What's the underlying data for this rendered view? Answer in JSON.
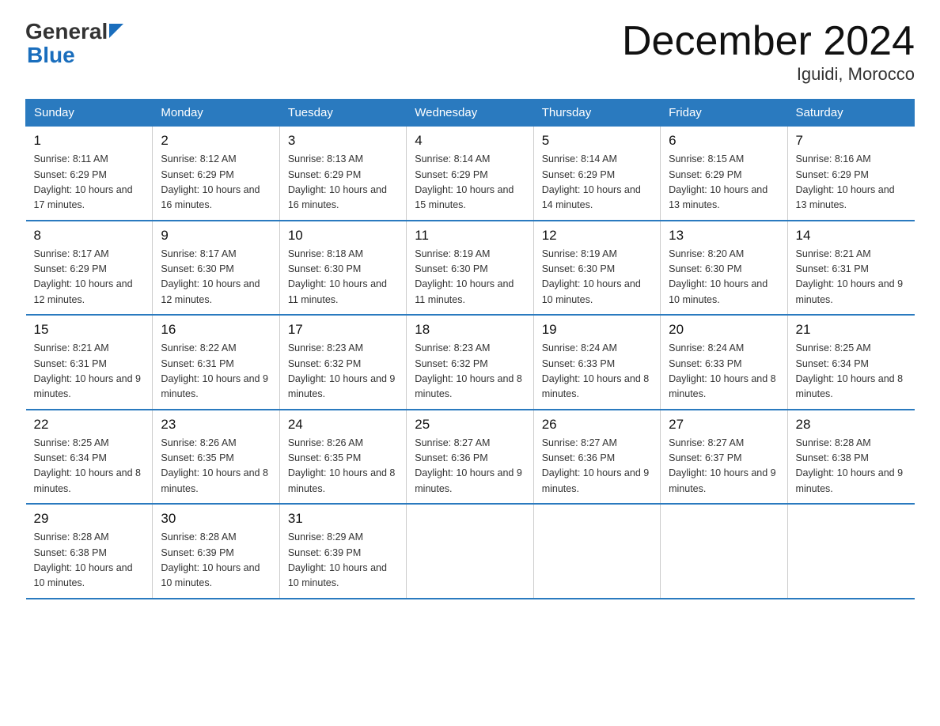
{
  "logo": {
    "general": "General",
    "blue": "Blue"
  },
  "title": "December 2024",
  "location": "Iguidi, Morocco",
  "days_of_week": [
    "Sunday",
    "Monday",
    "Tuesday",
    "Wednesday",
    "Thursday",
    "Friday",
    "Saturday"
  ],
  "weeks": [
    [
      {
        "day": "1",
        "sunrise": "8:11 AM",
        "sunset": "6:29 PM",
        "daylight": "10 hours and 17 minutes."
      },
      {
        "day": "2",
        "sunrise": "8:12 AM",
        "sunset": "6:29 PM",
        "daylight": "10 hours and 16 minutes."
      },
      {
        "day": "3",
        "sunrise": "8:13 AM",
        "sunset": "6:29 PM",
        "daylight": "10 hours and 16 minutes."
      },
      {
        "day": "4",
        "sunrise": "8:14 AM",
        "sunset": "6:29 PM",
        "daylight": "10 hours and 15 minutes."
      },
      {
        "day": "5",
        "sunrise": "8:14 AM",
        "sunset": "6:29 PM",
        "daylight": "10 hours and 14 minutes."
      },
      {
        "day": "6",
        "sunrise": "8:15 AM",
        "sunset": "6:29 PM",
        "daylight": "10 hours and 13 minutes."
      },
      {
        "day": "7",
        "sunrise": "8:16 AM",
        "sunset": "6:29 PM",
        "daylight": "10 hours and 13 minutes."
      }
    ],
    [
      {
        "day": "8",
        "sunrise": "8:17 AM",
        "sunset": "6:29 PM",
        "daylight": "10 hours and 12 minutes."
      },
      {
        "day": "9",
        "sunrise": "8:17 AM",
        "sunset": "6:30 PM",
        "daylight": "10 hours and 12 minutes."
      },
      {
        "day": "10",
        "sunrise": "8:18 AM",
        "sunset": "6:30 PM",
        "daylight": "10 hours and 11 minutes."
      },
      {
        "day": "11",
        "sunrise": "8:19 AM",
        "sunset": "6:30 PM",
        "daylight": "10 hours and 11 minutes."
      },
      {
        "day": "12",
        "sunrise": "8:19 AM",
        "sunset": "6:30 PM",
        "daylight": "10 hours and 10 minutes."
      },
      {
        "day": "13",
        "sunrise": "8:20 AM",
        "sunset": "6:30 PM",
        "daylight": "10 hours and 10 minutes."
      },
      {
        "day": "14",
        "sunrise": "8:21 AM",
        "sunset": "6:31 PM",
        "daylight": "10 hours and 9 minutes."
      }
    ],
    [
      {
        "day": "15",
        "sunrise": "8:21 AM",
        "sunset": "6:31 PM",
        "daylight": "10 hours and 9 minutes."
      },
      {
        "day": "16",
        "sunrise": "8:22 AM",
        "sunset": "6:31 PM",
        "daylight": "10 hours and 9 minutes."
      },
      {
        "day": "17",
        "sunrise": "8:23 AM",
        "sunset": "6:32 PM",
        "daylight": "10 hours and 9 minutes."
      },
      {
        "day": "18",
        "sunrise": "8:23 AM",
        "sunset": "6:32 PM",
        "daylight": "10 hours and 8 minutes."
      },
      {
        "day": "19",
        "sunrise": "8:24 AM",
        "sunset": "6:33 PM",
        "daylight": "10 hours and 8 minutes."
      },
      {
        "day": "20",
        "sunrise": "8:24 AM",
        "sunset": "6:33 PM",
        "daylight": "10 hours and 8 minutes."
      },
      {
        "day": "21",
        "sunrise": "8:25 AM",
        "sunset": "6:34 PM",
        "daylight": "10 hours and 8 minutes."
      }
    ],
    [
      {
        "day": "22",
        "sunrise": "8:25 AM",
        "sunset": "6:34 PM",
        "daylight": "10 hours and 8 minutes."
      },
      {
        "day": "23",
        "sunrise": "8:26 AM",
        "sunset": "6:35 PM",
        "daylight": "10 hours and 8 minutes."
      },
      {
        "day": "24",
        "sunrise": "8:26 AM",
        "sunset": "6:35 PM",
        "daylight": "10 hours and 8 minutes."
      },
      {
        "day": "25",
        "sunrise": "8:27 AM",
        "sunset": "6:36 PM",
        "daylight": "10 hours and 9 minutes."
      },
      {
        "day": "26",
        "sunrise": "8:27 AM",
        "sunset": "6:36 PM",
        "daylight": "10 hours and 9 minutes."
      },
      {
        "day": "27",
        "sunrise": "8:27 AM",
        "sunset": "6:37 PM",
        "daylight": "10 hours and 9 minutes."
      },
      {
        "day": "28",
        "sunrise": "8:28 AM",
        "sunset": "6:38 PM",
        "daylight": "10 hours and 9 minutes."
      }
    ],
    [
      {
        "day": "29",
        "sunrise": "8:28 AM",
        "sunset": "6:38 PM",
        "daylight": "10 hours and 10 minutes."
      },
      {
        "day": "30",
        "sunrise": "8:28 AM",
        "sunset": "6:39 PM",
        "daylight": "10 hours and 10 minutes."
      },
      {
        "day": "31",
        "sunrise": "8:29 AM",
        "sunset": "6:39 PM",
        "daylight": "10 hours and 10 minutes."
      },
      null,
      null,
      null,
      null
    ]
  ]
}
